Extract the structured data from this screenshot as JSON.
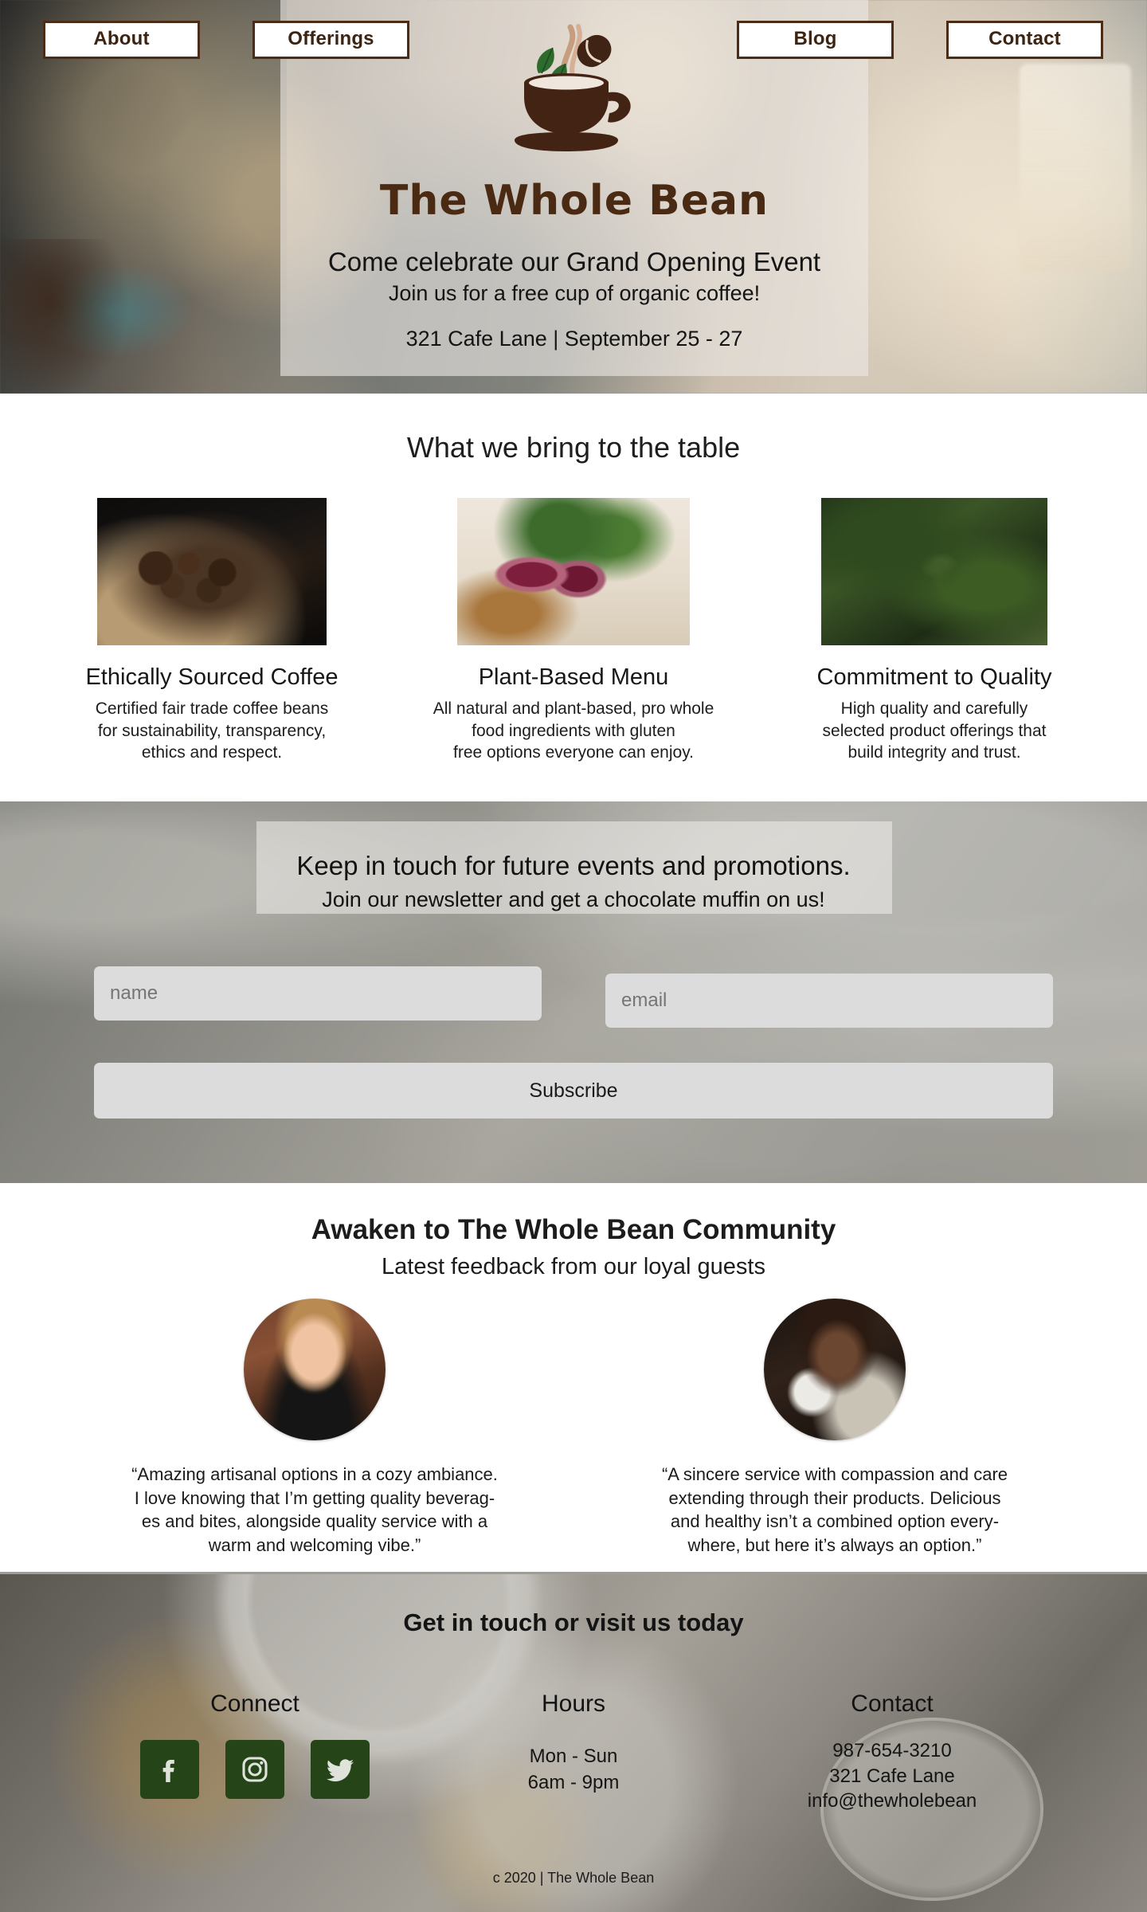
{
  "brand": {
    "name": "The Whole Bean",
    "logo_icon": "coffee-cup-with-leaves-and-bean-icon"
  },
  "nav": {
    "items": [
      {
        "label": "About",
        "name": "about"
      },
      {
        "label": "Offerings",
        "name": "offerings"
      },
      {
        "label": "Blog",
        "name": "blog"
      },
      {
        "label": "Contact",
        "name": "contact"
      }
    ]
  },
  "hero": {
    "headline": "Come celebrate our Grand Opening Event",
    "subheadline": "Join us for a free cup of organic coffee!",
    "details": "321 Cafe Lane | September 25 - 27"
  },
  "features": {
    "title": "What we bring to the table",
    "cards": [
      {
        "image_name": "coffee-beans-sack-photo",
        "title": "Ethically Sourced Coffee",
        "body": "Certified fair trade coffee beans\nfor sustainability, transparency,\nethics and respect."
      },
      {
        "image_name": "sliced-figs-and-walnuts-photo",
        "title": "Plant-Based Menu",
        "body": "All natural and plant-based, pro whole\nfood ingredients with gluten\nfree options everyone can enjoy."
      },
      {
        "image_name": "coffee-plant-branch-photo",
        "title": "Commitment to Quality",
        "body": "High quality and carefully\nselected product offerings that\nbuild integrity and trust."
      }
    ]
  },
  "newsletter": {
    "headline": "Keep in touch for future events and promotions.",
    "subheadline": "Join our newsletter and get a chocolate muffin on us!",
    "name_placeholder": "name",
    "email_placeholder": "email",
    "submit_label": "Subscribe"
  },
  "testimonials": {
    "title": "Awaken to The Whole Bean Community",
    "subtitle": "Latest feedback from our loyal guests",
    "items": [
      {
        "avatar_name": "guest-avatar-woman-photo",
        "quote": "“Amazing artisanal options in a cozy ambiance.\nI love knowing that I’m getting quality beverag-\nes and bites, alongside quality service with a\nwarm and welcoming vibe.”"
      },
      {
        "avatar_name": "guest-avatar-woman-with-cup-photo",
        "quote": "“A sincere service with compassion and care\nextending through their products. Delicious\nand healthy isn’t a combined option every-\nwhere, but here it’s always an option.”"
      }
    ]
  },
  "footer": {
    "title": "Get in touch or visit us today",
    "connect": {
      "heading": "Connect",
      "socials": [
        {
          "name": "facebook-icon",
          "glyph": "f"
        },
        {
          "name": "instagram-icon",
          "glyph": "instagram"
        },
        {
          "name": "twitter-icon",
          "glyph": "twitter"
        }
      ]
    },
    "hours": {
      "heading": "Hours",
      "text": "Mon - Sun\n6am - 9pm"
    },
    "contact": {
      "heading": "Contact",
      "text": "987-654-3210\n321 Cafe Lane\ninfo@thewholebean"
    },
    "copyright": "c 2020 | The Whole Bean"
  },
  "colors": {
    "brand_brown": "#4a2a12",
    "nav_border": "#4a2c17",
    "social_green": "#254418",
    "field_gray": "#dcdcdc"
  }
}
